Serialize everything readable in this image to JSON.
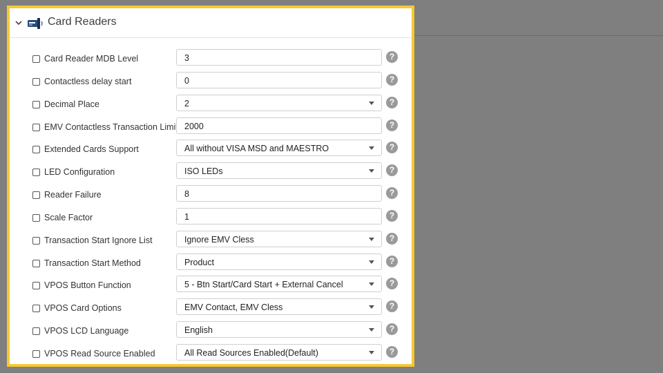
{
  "section": {
    "title": "Card Readers",
    "icon": "card-reader-icon",
    "expanded": true
  },
  "rows": [
    {
      "id": "card-reader-mdb-level",
      "label": "Card Reader MDB Level",
      "value": "3",
      "type": "text"
    },
    {
      "id": "contactless-delay-start",
      "label": "Contactless delay start",
      "value": "0",
      "type": "text"
    },
    {
      "id": "decimal-place",
      "label": "Decimal Place",
      "value": "2",
      "type": "select"
    },
    {
      "id": "emv-contactless-transaction-limit",
      "label": "EMV Contactless Transaction Limit",
      "value": "2000",
      "type": "text"
    },
    {
      "id": "extended-cards-support",
      "label": "Extended Cards Support",
      "value": "All without VISA MSD and MAESTRO",
      "type": "select"
    },
    {
      "id": "led-configuration",
      "label": "LED Configuration",
      "value": "ISO LEDs",
      "type": "select"
    },
    {
      "id": "reader-failure",
      "label": "Reader Failure",
      "value": "8",
      "type": "text"
    },
    {
      "id": "scale-factor",
      "label": "Scale Factor",
      "value": "1",
      "type": "text"
    },
    {
      "id": "transaction-start-ignore-list",
      "label": "Transaction Start Ignore List",
      "value": "Ignore EMV Cless",
      "type": "select"
    },
    {
      "id": "transaction-start-method",
      "label": "Transaction Start Method",
      "value": "Product",
      "type": "select"
    },
    {
      "id": "vpos-button-function",
      "label": "VPOS Button Function",
      "value": "5 - Btn Start/Card Start + External Cancel",
      "type": "select"
    },
    {
      "id": "vpos-card-options",
      "label": "VPOS Card Options",
      "value": "EMV Contact, EMV Cless",
      "type": "select"
    },
    {
      "id": "vpos-lcd-language",
      "label": "VPOS LCD Language",
      "value": "English",
      "type": "select"
    },
    {
      "id": "vpos-read-source-enabled",
      "label": "VPOS Read Source Enabled",
      "value": "All Read Sources Enabled(Default)",
      "type": "select"
    }
  ],
  "help_glyph": "?",
  "colors": {
    "highlight_border": "#f5c932",
    "background": "#7f7f7f",
    "help_icon": "#9a9a9a"
  }
}
